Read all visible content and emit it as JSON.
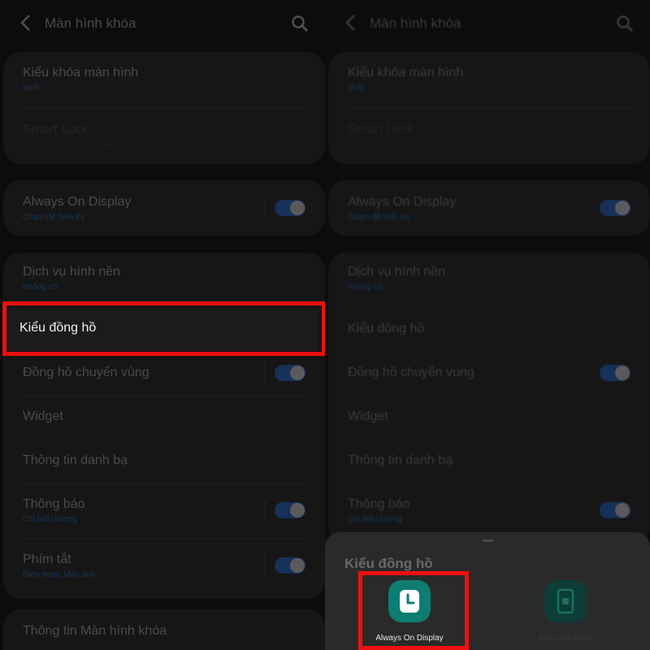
{
  "appbar": {
    "title": "Màn hình khóa"
  },
  "settings": {
    "lock_type": {
      "title": "Kiểu khóa màn hình",
      "value": "Vuốt"
    },
    "smart_lock": {
      "title": "Smart Lock",
      "desc": "Giữ thiết bị mở khóa khi đang ở nơi an toàn"
    },
    "aod": {
      "title": "Always On Display",
      "desc": "Chạm để hiển thị",
      "enabled": true
    },
    "wallpaper_service": {
      "title": "Dịch vụ hình nền",
      "value": "Không có"
    },
    "clock_style": {
      "title": "Kiểu đồng hồ"
    },
    "roaming_clock": {
      "title": "Đồng hồ chuyển vùng",
      "enabled": true
    },
    "widgets": {
      "title": "Widget"
    },
    "contact_info": {
      "title": "Thông tin danh bạ"
    },
    "notifications": {
      "title": "Thông báo",
      "value": "Chỉ biểu tượng",
      "enabled": true
    },
    "shortcuts": {
      "title": "Phím tắt",
      "value": "Điện thoại, Máy ảnh",
      "enabled": true
    },
    "about": {
      "title": "Thông tin Màn hình khóa"
    }
  },
  "sheet": {
    "title": "Kiểu đồng hồ",
    "options": [
      {
        "label": "Always On Display",
        "icon": "clock-icon",
        "color": "#0e7d72"
      },
      {
        "label": "Màn hình khóa",
        "icon": "lock-screen-icon",
        "color": "#0c3d37"
      }
    ]
  },
  "colors": {
    "highlight": "#ee1010",
    "toggle_on": "#3e7bd9",
    "accent_text": "#3d78c9"
  }
}
